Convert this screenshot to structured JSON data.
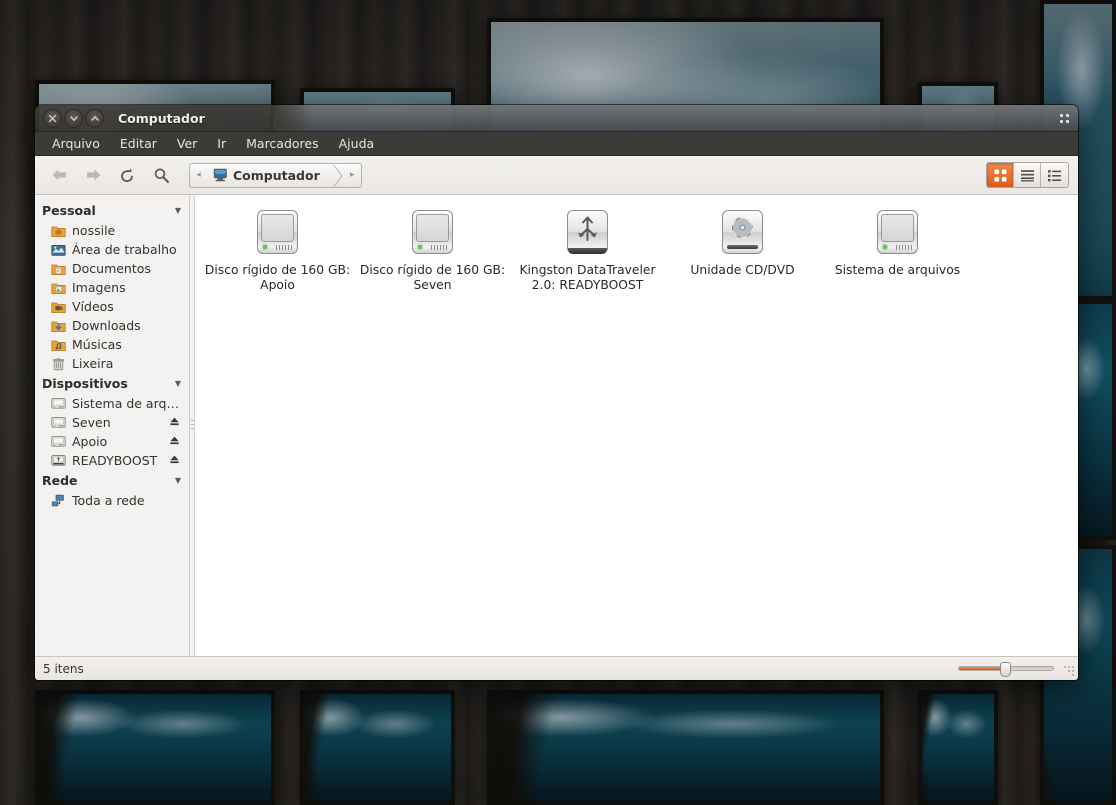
{
  "window": {
    "title": "Computador",
    "controls": [
      {
        "name": "close",
        "glyph": "close-icon"
      },
      {
        "name": "minimize",
        "glyph": "minimize-icon"
      },
      {
        "name": "maximize",
        "glyph": "maximize-icon"
      }
    ]
  },
  "menubar": [
    {
      "label": "Arquivo"
    },
    {
      "label": "Editar"
    },
    {
      "label": "Ver"
    },
    {
      "label": "Ir"
    },
    {
      "label": "Marcadores"
    },
    {
      "label": "Ajuda"
    }
  ],
  "toolbar": {
    "back": "back-arrow-icon",
    "forward": "forward-arrow-icon",
    "reload": "reload-icon",
    "search": "search-icon",
    "pathbar": {
      "prev_arrow": "◂",
      "next_arrow": "▸",
      "crumb_label": "Computador",
      "crumb_icon": "computer-icon"
    },
    "views": [
      {
        "name": "icon-view",
        "active": true
      },
      {
        "name": "list-view",
        "active": false
      },
      {
        "name": "compact-view",
        "active": false
      }
    ]
  },
  "sidebar": {
    "sections": [
      {
        "title": "Pessoal",
        "expanded_glyph": "▼",
        "items": [
          {
            "label": "nossile",
            "icon": "home-folder-icon",
            "eject": false
          },
          {
            "label": "Área de trabalho",
            "icon": "desktop-folder-icon",
            "eject": false
          },
          {
            "label": "Documentos",
            "icon": "documents-folder-icon",
            "eject": false
          },
          {
            "label": "Imagens",
            "icon": "pictures-folder-icon",
            "eject": false
          },
          {
            "label": "Vídeos",
            "icon": "videos-folder-icon",
            "eject": false
          },
          {
            "label": "Downloads",
            "icon": "downloads-folder-icon",
            "eject": false
          },
          {
            "label": "Músicas",
            "icon": "music-folder-icon",
            "eject": false
          },
          {
            "label": "Lixeira",
            "icon": "trash-icon",
            "eject": false
          }
        ]
      },
      {
        "title": "Dispositivos",
        "expanded_glyph": "▼",
        "items": [
          {
            "label": "Sistema de arquivos",
            "icon": "drive-icon",
            "eject": false
          },
          {
            "label": "Seven",
            "icon": "drive-icon",
            "eject": true
          },
          {
            "label": "Apoio",
            "icon": "drive-icon",
            "eject": true
          },
          {
            "label": "READYBOOST",
            "icon": "usb-drive-icon",
            "eject": true
          }
        ]
      },
      {
        "title": "Rede",
        "expanded_glyph": "▼",
        "items": [
          {
            "label": "Toda a rede",
            "icon": "network-icon",
            "eject": false
          }
        ]
      }
    ],
    "eject_glyph": "⏏"
  },
  "content": {
    "items": [
      {
        "caption": "Disco rígido de 160 GB: Apoio",
        "icon": "hard-drive-icon"
      },
      {
        "caption": "Disco rígido de 160 GB: Seven",
        "icon": "hard-drive-icon"
      },
      {
        "caption": "Kingston DataTraveler 2.0: READYBOOST",
        "icon": "usb-drive-icon"
      },
      {
        "caption": "Unidade CD/DVD",
        "icon": "cd-dvd-drive-icon"
      },
      {
        "caption": "Sistema de arquivos",
        "icon": "filesystem-drive-icon"
      }
    ]
  },
  "statusbar": {
    "text": "5 itens",
    "zoom_slider": "zoom-slider"
  },
  "colors": {
    "accent_orange": "#dd5c18",
    "titlebar": "#3c3b37",
    "menubar": "#3c3b37",
    "sidebar_bg": "#f4f2f0",
    "content_bg": "#ffffff"
  }
}
